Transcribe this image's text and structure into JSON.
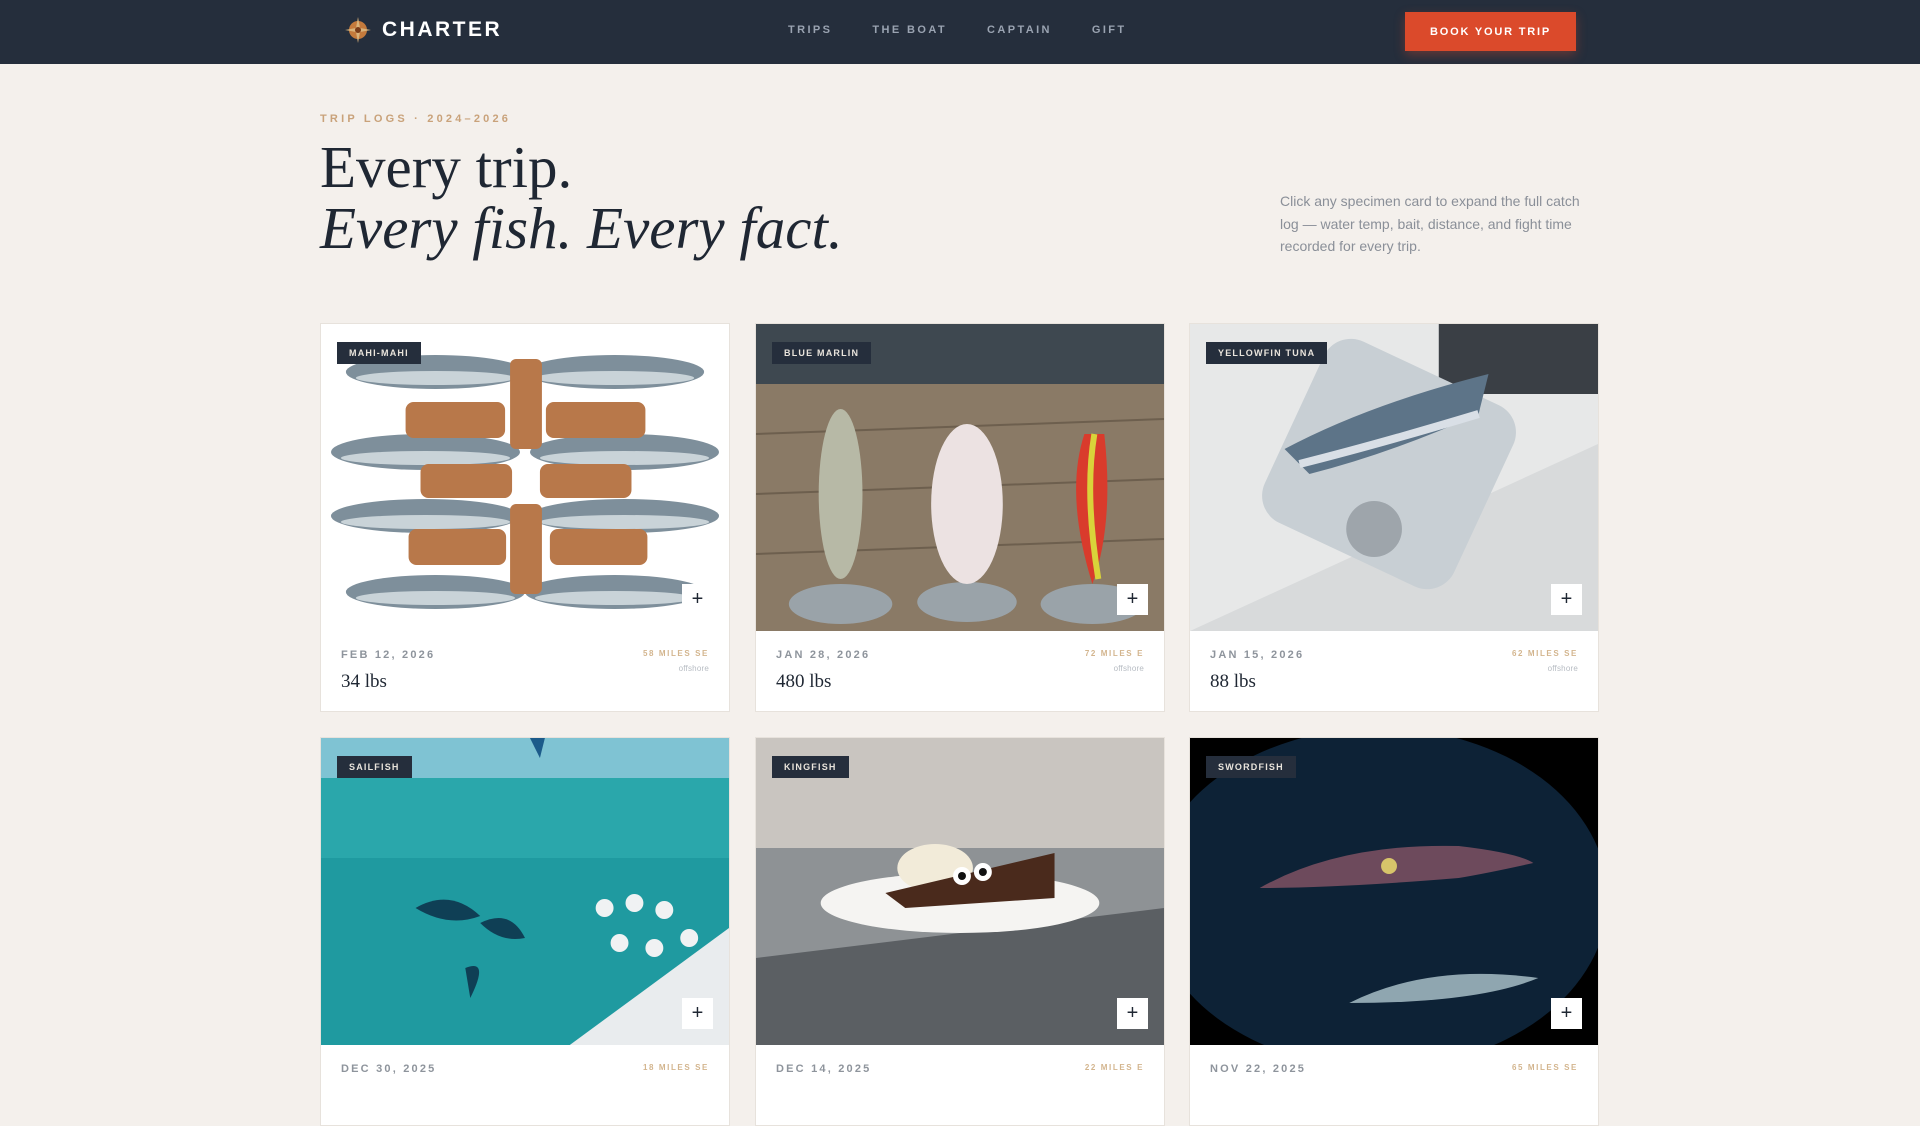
{
  "brand": {
    "name": "CHARTER"
  },
  "nav": {
    "links": [
      "TRIPS",
      "THE BOAT",
      "CAPTAIN",
      "GIFT"
    ],
    "cta": "BOOK YOUR TRIP"
  },
  "hero": {
    "eyebrow": "TRIP LOGS · 2024–2026",
    "title_line1": "Every trip.",
    "title_line2": "Every fish. Every fact.",
    "note": "Click any specimen card to expand the full catch log — water temp, bait, distance, and fight time recorded for every trip."
  },
  "cards": [
    {
      "species": "MAHI-MAHI",
      "date": "FEB 12, 2026",
      "weight": "34 lbs",
      "distance": "58 MILES SE",
      "zone": "offshore",
      "photo": "sardines-and-wood-rollers"
    },
    {
      "species": "BLUE MARLIN",
      "date": "JAN 28, 2026",
      "weight": "480 lbs",
      "distance": "72 MILES E",
      "zone": "offshore",
      "photo": "rigged-baits-on-dock"
    },
    {
      "species": "YELLOWFIN TUNA",
      "date": "JAN 15, 2026",
      "weight": "88 lbs",
      "distance": "62 MILES SE",
      "zone": "offshore",
      "photo": "small-tuna-in-plastic-cup"
    },
    {
      "species": "SAILFISH",
      "date": "DEC 30, 2025",
      "weight": "",
      "distance": "18 MILES SE",
      "zone": "",
      "photo": "crew-on-boat-with-jumping-sailfish"
    },
    {
      "species": "KINGFISH",
      "date": "DEC 14, 2025",
      "weight": "",
      "distance": "22 MILES E",
      "zone": "",
      "photo": "chocolate-cake-with-googly-eyes"
    },
    {
      "species": "SWORDFISH",
      "date": "NOV 22, 2025",
      "weight": "",
      "distance": "65 MILES SE",
      "zone": "",
      "photo": "squid-and-fish-underwater"
    }
  ],
  "colors": {
    "nav_bg": "#252e3c",
    "cta": "#db4a2b",
    "page_bg": "#f4f0ec",
    "accent_gold": "#c9a27a"
  },
  "icons": {
    "logo": "compass-rose-icon",
    "expand": "plus-icon"
  }
}
